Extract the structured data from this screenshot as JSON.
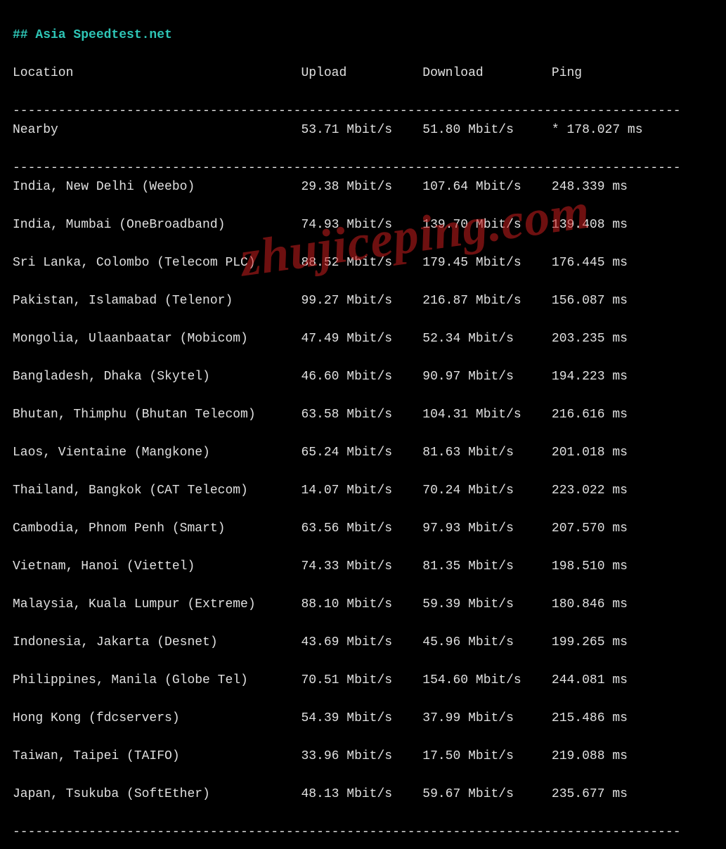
{
  "title": "## Asia Speedtest.net",
  "columns": {
    "location": "Location",
    "upload": "Upload",
    "download": "Download",
    "ping": "Ping"
  },
  "divider": "----------------------------------------------------------------------------------------",
  "nearby": {
    "location": "Nearby",
    "upload": "53.71 Mbit/s",
    "download": "51.80 Mbit/s",
    "ping": "* 178.027 ms"
  },
  "rows": [
    {
      "location": "India, New Delhi (Weebo)",
      "upload": "29.38 Mbit/s",
      "download": "107.64 Mbit/s",
      "ping": "248.339 ms"
    },
    {
      "location": "India, Mumbai (OneBroadband)",
      "upload": "74.93 Mbit/s",
      "download": "139.70 Mbit/s",
      "ping": "139.408 ms"
    },
    {
      "location": "Sri Lanka, Colombo (Telecom PLC)",
      "upload": "88.52 Mbit/s",
      "download": "179.45 Mbit/s",
      "ping": "176.445 ms"
    },
    {
      "location": "Pakistan, Islamabad (Telenor)",
      "upload": "99.27 Mbit/s",
      "download": "216.87 Mbit/s",
      "ping": "156.087 ms"
    },
    {
      "location": "Mongolia, Ulaanbaatar (Mobicom)",
      "upload": "47.49 Mbit/s",
      "download": "52.34 Mbit/s",
      "ping": "203.235 ms"
    },
    {
      "location": "Bangladesh, Dhaka (Skytel)",
      "upload": "46.60 Mbit/s",
      "download": "90.97 Mbit/s",
      "ping": "194.223 ms"
    },
    {
      "location": "Bhutan, Thimphu (Bhutan Telecom)",
      "upload": "63.58 Mbit/s",
      "download": "104.31 Mbit/s",
      "ping": "216.616 ms"
    },
    {
      "location": "Laos, Vientaine (Mangkone)",
      "upload": "65.24 Mbit/s",
      "download": "81.63 Mbit/s",
      "ping": "201.018 ms"
    },
    {
      "location": "Thailand, Bangkok (CAT Telecom)",
      "upload": "14.07 Mbit/s",
      "download": "70.24 Mbit/s",
      "ping": "223.022 ms"
    },
    {
      "location": "Cambodia, Phnom Penh (Smart)",
      "upload": "63.56 Mbit/s",
      "download": "97.93 Mbit/s",
      "ping": "207.570 ms"
    },
    {
      "location": "Vietnam, Hanoi (Viettel)",
      "upload": "74.33 Mbit/s",
      "download": "81.35 Mbit/s",
      "ping": "198.510 ms"
    },
    {
      "location": "Malaysia, Kuala Lumpur (Extreme)",
      "upload": "88.10 Mbit/s",
      "download": "59.39 Mbit/s",
      "ping": "180.846 ms"
    },
    {
      "location": "Indonesia, Jakarta (Desnet)",
      "upload": "43.69 Mbit/s",
      "download": "45.96 Mbit/s",
      "ping": "199.265 ms"
    },
    {
      "location": "Philippines, Manila (Globe Tel)",
      "upload": "70.51 Mbit/s",
      "download": "154.60 Mbit/s",
      "ping": "244.081 ms"
    },
    {
      "location": "Hong Kong (fdcservers)",
      "upload": "54.39 Mbit/s",
      "download": "37.99 Mbit/s",
      "ping": "215.486 ms"
    },
    {
      "location": "Taiwan, Taipei (TAIFO)",
      "upload": "33.96 Mbit/s",
      "download": "17.50 Mbit/s",
      "ping": "219.088 ms"
    },
    {
      "location": "Japan, Tsukuba (SoftEther)",
      "upload": "48.13 Mbit/s",
      "download": "59.67 Mbit/s",
      "ping": "235.677 ms"
    }
  ],
  "watermark": "zhujiceping.com"
}
